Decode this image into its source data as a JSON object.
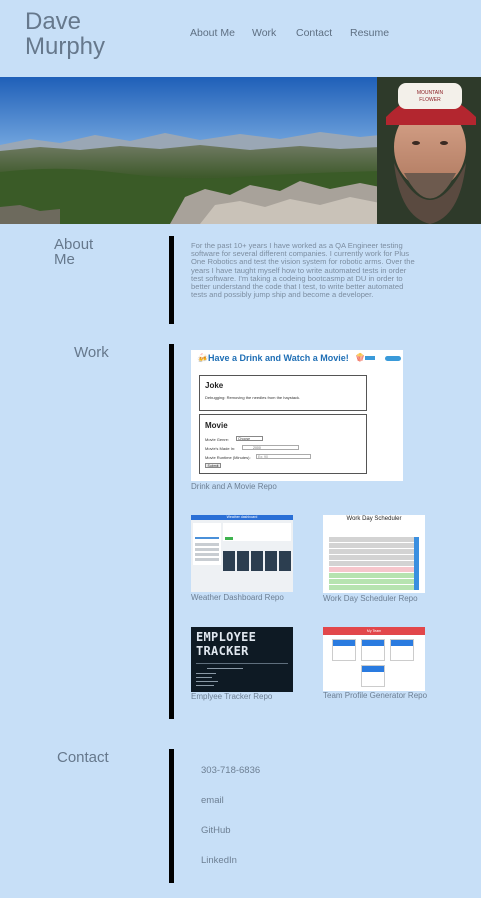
{
  "header": {
    "name_first": "Dave",
    "name_last": "Murphy",
    "nav": [
      "About Me",
      "Work",
      "Contact",
      "Resume"
    ]
  },
  "about": {
    "title_line1": "About",
    "title_line2": "Me",
    "text": "For the past 10+ years I have worked as a QA Engineer testing software for several different companies. I currently work for Plus One Robotics and test the vision system for robotic arms. Over the years I have taught myself how to write automated tests in order test software. I'm taking a codeing bootcasmp at DU in order to better understand the code that I test, to write better automated tests and possibly jump ship and become a developer."
  },
  "work": {
    "title": "Work",
    "projects": [
      {
        "caption": "Drink and A Movie Repo",
        "thumb": {
          "heading": "Have a Drink and Watch a Movie!",
          "joke_title": "Joke",
          "joke_text": "Debugging: Removing the needles from the haystack.",
          "movie_title": "Movie",
          "genre_label": "Movie Genre:",
          "genre_value": "Choose",
          "made_label": "Movie's Made In:",
          "made_value": "2000",
          "runtime_label": "Movie Runtime (Minutes):",
          "runtime_placeholder": "Ex: 90",
          "submit": "Submit"
        }
      },
      {
        "caption": "Weather Dashboard Repo",
        "thumb": {
          "heading": "Weather dashboard"
        }
      },
      {
        "caption": "Work Day Scheduler Repo",
        "thumb": {
          "heading": "Work Day Scheduler"
        }
      },
      {
        "caption": "Emplyee Tracker Repo",
        "thumb": {
          "heading_line1": "EMPLOYEE",
          "heading_line2": "TRACKER"
        }
      },
      {
        "caption": "Team Profile Generator Repo",
        "thumb": {
          "heading": "My Team"
        }
      }
    ]
  },
  "contact": {
    "title": "Contact",
    "phone": "303-718-6836",
    "email": "email",
    "github": "GitHub",
    "linkedin": "LinkedIn"
  },
  "colors": {
    "page_background": "#c7dff7",
    "accent_bar": "#000000",
    "heading_blue": "#1f6fb5"
  }
}
